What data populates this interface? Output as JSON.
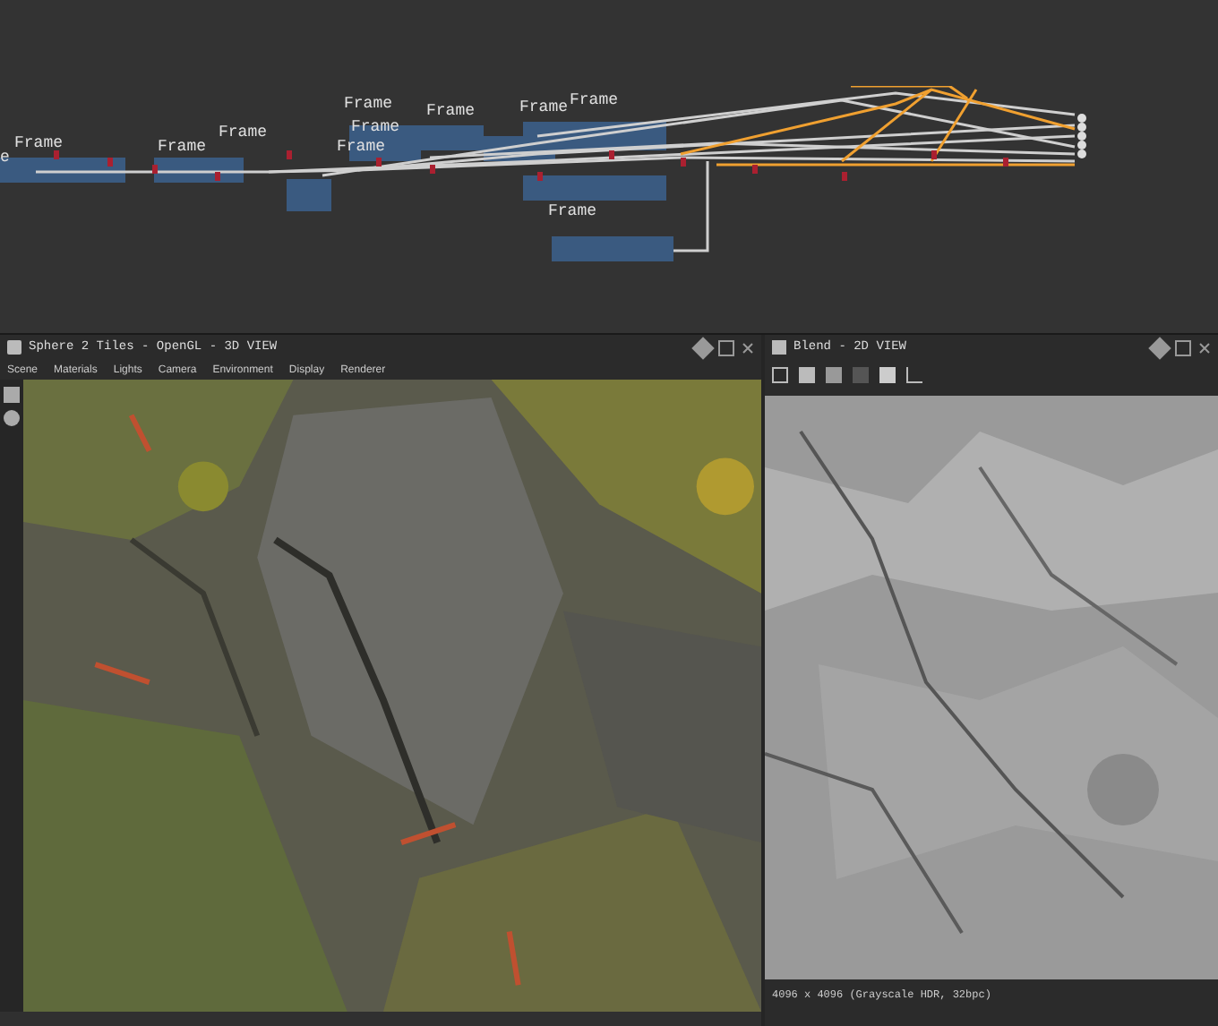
{
  "graph": {
    "frames": [
      "e",
      "Frame",
      "Frame",
      "Frame",
      "Frame",
      "Frame",
      "Frame",
      "Frame",
      "Frame",
      "Frame",
      "Frame"
    ]
  },
  "view3d": {
    "title": "Sphere 2 Tiles - OpenGL - 3D VIEW",
    "menu": [
      "Scene",
      "Materials",
      "Lights",
      "Camera",
      "Environment",
      "Display",
      "Renderer"
    ]
  },
  "view2d": {
    "title": "Blend - 2D VIEW",
    "info": "4096 x 4096 (Grayscale HDR, 32bpc)"
  }
}
